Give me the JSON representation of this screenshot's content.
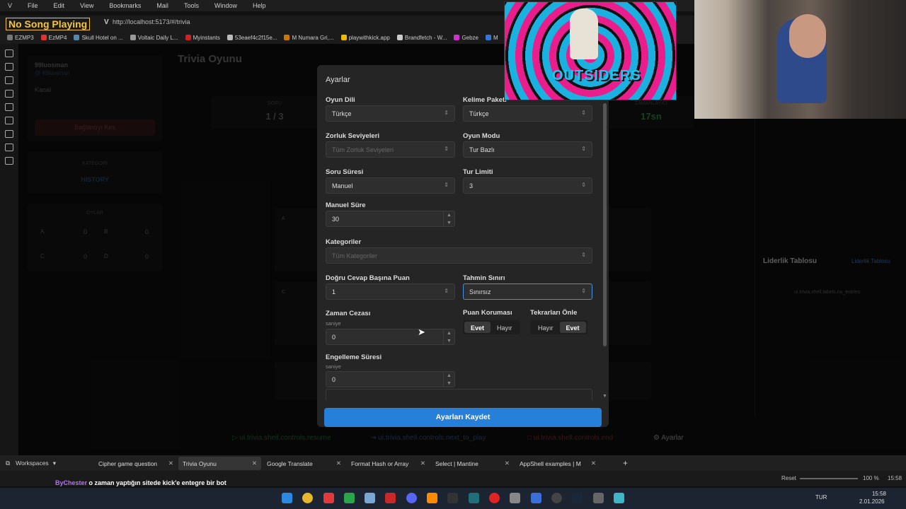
{
  "browser": {
    "menu": [
      "File",
      "Edit",
      "View",
      "Bookmarks",
      "Mail",
      "Tools",
      "Window",
      "Help"
    ],
    "song_badge": "No Song Playing",
    "url": "http://localhost:5173/#/trivia",
    "bookmarks": [
      {
        "label": "EZMP3",
        "color": "#777"
      },
      {
        "label": "EzMP4",
        "color": "#d33"
      },
      {
        "label": "Skull Hotel on ...",
        "color": "#58a"
      },
      {
        "label": "Voltaic Daily L...",
        "color": "#999"
      },
      {
        "label": "Myinstants",
        "color": "#c22"
      },
      {
        "label": "53eaef4c2f15e...",
        "color": "#bbb"
      },
      {
        "label": "M Numara Gri,...",
        "color": "#c70"
      },
      {
        "label": "playwithkick.app",
        "color": "#eb0"
      },
      {
        "label": "Brandfetch - W...",
        "color": "#ccc"
      },
      {
        "label": "Gebze",
        "color": "#c3c"
      },
      {
        "label": "M",
        "color": "#37d"
      }
    ]
  },
  "app": {
    "page_title": "Trivia Oyunu",
    "user": {
      "name": "99luosman",
      "handle": "@ 99luosman"
    },
    "channel_label": "Kanal",
    "disconnect_label": "Bağlantıyı Kes",
    "category_label": "KATEGORİ",
    "category_value": "HISTORY",
    "votes_label": "OYLAR",
    "votes": [
      {
        "k": "A",
        "v": "0"
      },
      {
        "k": "B",
        "v": "0"
      },
      {
        "k": "C",
        "v": "0"
      },
      {
        "k": "D",
        "v": "0"
      }
    ],
    "question_label": "SORU",
    "question_value": "1 / 3",
    "timer_label": "ZAMANLAYICI",
    "timer_value": "17sn",
    "option_a": "A",
    "option_c": "C",
    "leaderboard_title": "Liderlik Tablosu",
    "leaderboard_link": "Liderlik Tablosu",
    "leaderboard_empty": "ui.trivia.shell.labels.no_entries",
    "controls": {
      "resume": "ui.trivia.shell.controls.resume",
      "next": "ui.trivia.shell.controls.next_to_play",
      "end": "ui.trivia.shell.controls.end",
      "settings": "Ayarlar"
    }
  },
  "modal": {
    "title": "Ayarlar",
    "game_language": {
      "label": "Oyun Dili",
      "value": "Türkçe"
    },
    "word_pack": {
      "label": "Kelime Paketi",
      "value": "Türkçe"
    },
    "difficulty": {
      "label": "Zorluk Seviyeleri",
      "placeholder": "Tüm Zorluk Seviyeleri"
    },
    "game_mode": {
      "label": "Oyun Modu",
      "value": "Tur Bazlı"
    },
    "question_time": {
      "label": "Soru Süresi",
      "value": "Manuel"
    },
    "round_limit": {
      "label": "Tur Limiti",
      "value": "3"
    },
    "manual_time": {
      "label": "Manuel Süre",
      "value": "30"
    },
    "categories": {
      "label": "Kategoriler",
      "placeholder": "Tüm Kategoriler"
    },
    "points_per_answer": {
      "label": "Doğru Cevap Başına Puan",
      "value": "1"
    },
    "guess_limit": {
      "label": "Tahmin Sınırı",
      "value": "Sınırsız"
    },
    "time_penalty": {
      "label": "Zaman Cezası",
      "unit": "saniye",
      "value": "0"
    },
    "score_protection": {
      "label": "Puan Koruması",
      "yes": "Evet",
      "no": "Hayır"
    },
    "prevent_repeats": {
      "label": "Tekrarları Önle",
      "no": "Hayır",
      "yes": "Evet"
    },
    "block_duration": {
      "label": "Engelleme Süresi",
      "unit": "saniye",
      "value": "0"
    },
    "save_label": "Ayarları Kaydet"
  },
  "tabs": {
    "workspaces": "Workspaces",
    "items": [
      {
        "label": "Cipher game question"
      },
      {
        "label": "Trivia Oyunu"
      },
      {
        "label": "Google Translate"
      },
      {
        "label": "Format Hash or Array"
      },
      {
        "label": "Select | Mantine"
      },
      {
        "label": "AppShell examples | M"
      }
    ]
  },
  "status": {
    "reset": "Reset",
    "zoom": "100 %",
    "time": "15:58",
    "chat_user": "ByChester",
    "chat_text": "o zaman yaptığın sitede kick'e entegre bir bot",
    "lang": "TUR",
    "clock": "15:58",
    "date": "2.01.2026"
  },
  "overlay": {
    "game_title": "OUTSIDERS"
  },
  "colors": {
    "accent": "#2680d9",
    "timer": "#3ab85a",
    "link": "#4a90e2",
    "danger": "#e04848",
    "resume": "#3ab85a"
  }
}
